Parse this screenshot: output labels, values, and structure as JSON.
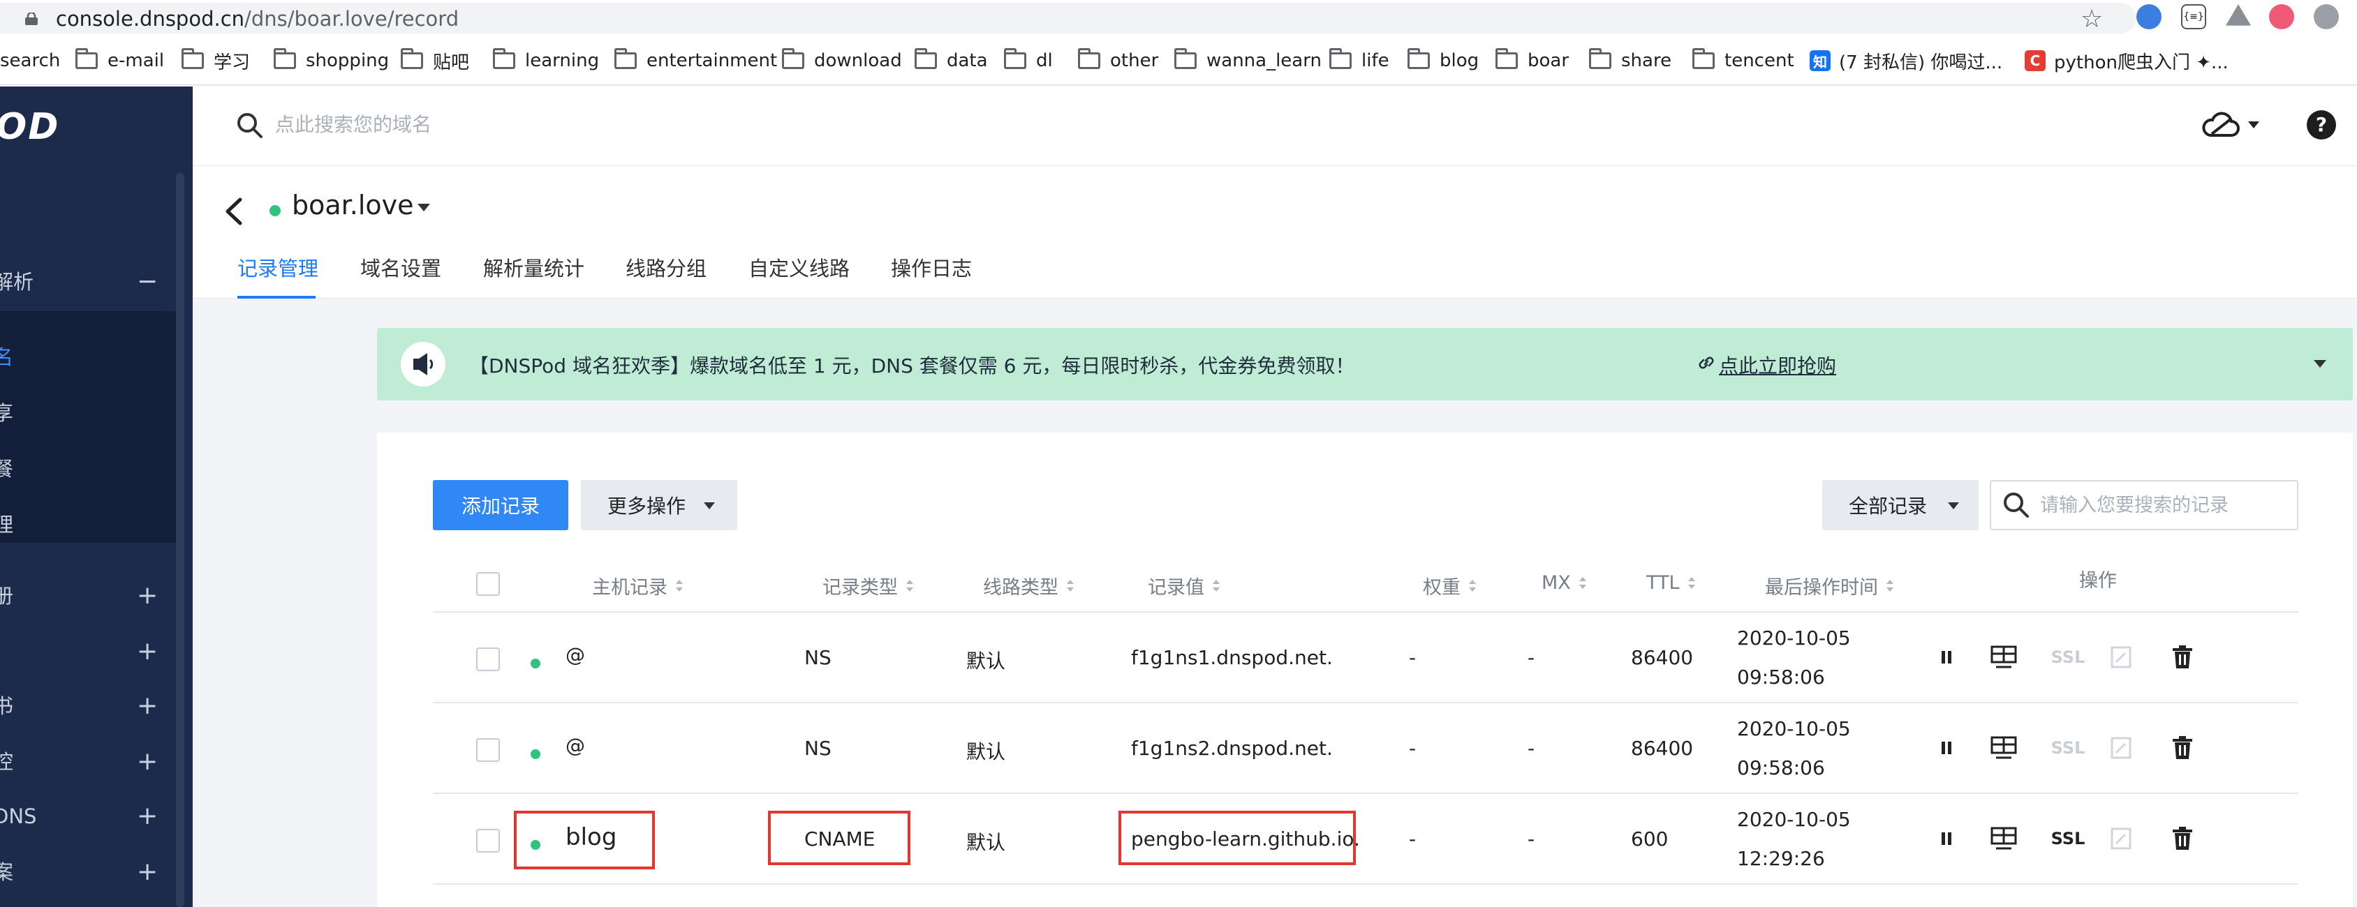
{
  "browser": {
    "url_host": "console.dnspod.cn",
    "url_path": "/dns/boar.love/record",
    "bookmarks": [
      {
        "label": "search",
        "icon": "none"
      },
      {
        "label": "e-mail",
        "icon": "folder-icon"
      },
      {
        "label": "学习",
        "icon": "folder-icon"
      },
      {
        "label": "shopping",
        "icon": "folder-icon"
      },
      {
        "label": "贴吧",
        "icon": "folder-icon"
      },
      {
        "label": "learning",
        "icon": "folder-icon"
      },
      {
        "label": "entertainment",
        "icon": "folder-icon"
      },
      {
        "label": "download",
        "icon": "folder-icon"
      },
      {
        "label": "data",
        "icon": "folder-icon"
      },
      {
        "label": "dl",
        "icon": "folder-icon"
      },
      {
        "label": "other",
        "icon": "folder-icon"
      },
      {
        "label": "wanna_learn",
        "icon": "folder-icon"
      },
      {
        "label": "life",
        "icon": "folder-icon"
      },
      {
        "label": "blog",
        "icon": "folder-icon"
      },
      {
        "label": "boar",
        "icon": "folder-icon"
      },
      {
        "label": "share",
        "icon": "folder-icon"
      },
      {
        "label": "tencent",
        "icon": "folder-icon"
      },
      {
        "label": "(7 封私信) 你喝过...",
        "icon": "zhihu-icon",
        "badge": "知"
      },
      {
        "label": "python爬虫入门 ✦...",
        "icon": "csdn-icon",
        "badge": "C"
      }
    ]
  },
  "sidebar": {
    "logo": "OD",
    "items": [
      {
        "label": "",
        "sign": ""
      },
      {
        "label": "解析",
        "sign": "−"
      },
      {
        "label": "名",
        "sign": "",
        "active": true
      },
      {
        "label": "享",
        "sign": ""
      },
      {
        "label": "餐",
        "sign": ""
      },
      {
        "label": "理",
        "sign": ""
      },
      {
        "label": "册",
        "sign": "+"
      },
      {
        "label": "",
        "sign": "+"
      },
      {
        "label": "书",
        "sign": "+"
      },
      {
        "label": "控",
        "sign": "+"
      },
      {
        "label": "DNS",
        "sign": "+"
      },
      {
        "label": "案",
        "sign": "+"
      }
    ]
  },
  "topbar": {
    "search_placeholder": "点此搜索您的域名",
    "help_label": "?"
  },
  "domain": {
    "name": "boar.love",
    "tabs": [
      "记录管理",
      "域名设置",
      "解析量统计",
      "线路分组",
      "自定义线路",
      "操作日志"
    ]
  },
  "banner": {
    "text": "【DNSPod 域名狂欢季】爆款域名低至 1 元，DNS 套餐仅需 6 元，每日限时秒杀，代金券免费领取！",
    "link": "点此立即抢购"
  },
  "toolbar": {
    "add_label": "添加记录",
    "more_label": "更多操作",
    "filter_label": "全部记录",
    "search_placeholder": "请输入您要搜索的记录"
  },
  "table": {
    "headers": {
      "host": "主机记录",
      "type": "记录类型",
      "line": "线路类型",
      "value": "记录值",
      "weight": "权重",
      "mx": "MX",
      "ttl": "TTL",
      "time": "最后操作时间",
      "ops": "操作"
    },
    "rows": [
      {
        "host": "@",
        "type": "NS",
        "line": "默认",
        "value": "f1g1ns1.dnspod.net.",
        "weight": "-",
        "mx": "-",
        "ttl": "86400",
        "date": "2020-10-05",
        "time": "09:58:06",
        "ssl": "SSL",
        "ssl_enabled": false,
        "highlighted": false
      },
      {
        "host": "@",
        "type": "NS",
        "line": "默认",
        "value": "f1g1ns2.dnspod.net.",
        "weight": "-",
        "mx": "-",
        "ttl": "86400",
        "date": "2020-10-05",
        "time": "09:58:06",
        "ssl": "SSL",
        "ssl_enabled": false,
        "highlighted": false
      },
      {
        "host": "blog",
        "type": "CNAME",
        "line": "默认",
        "value": "pengbo-learn.github.io.",
        "weight": "-",
        "mx": "-",
        "ttl": "600",
        "date": "2020-10-05",
        "time": "12:29:26",
        "ssl": "SSL",
        "ssl_enabled": true,
        "highlighted": true
      }
    ]
  },
  "colors": {
    "accent": "#1a7af8",
    "sidebar": "#1c2b4b",
    "banner": "#c0ebd5",
    "status_dot": "#2fc37b",
    "highlight": "#e2362f"
  }
}
